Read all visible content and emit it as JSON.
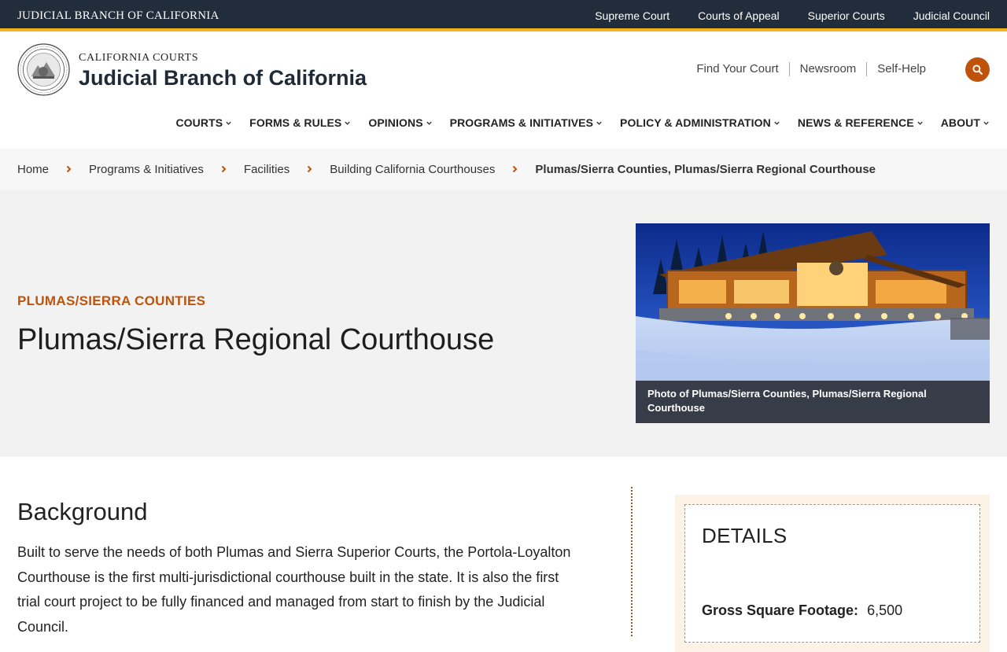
{
  "topbar": {
    "brand": "JUDICIAL BRANCH OF CALIFORNIA",
    "links": [
      "Supreme Court",
      "Courts of Appeal",
      "Superior Courts",
      "Judicial Council"
    ]
  },
  "header": {
    "small_title": "CALIFORNIA COURTS",
    "big_title": "Judicial Branch of California",
    "utility_links": [
      "Find Your Court",
      "Newsroom",
      "Self-Help"
    ],
    "search_icon": "search-icon",
    "accent_color": "#c0530b",
    "dark_color": "#212d3a",
    "gold_color": "#f2b31b"
  },
  "nav": {
    "items": [
      "COURTS",
      "FORMS & RULES",
      "OPINIONS",
      "PROGRAMS & INITIATIVES",
      "POLICY & ADMINISTRATION",
      "NEWS & REFERENCE",
      "ABOUT"
    ]
  },
  "breadcrumb": {
    "items": [
      "Home",
      "Programs & Initiatives",
      "Facilities",
      "Building California Courthouses"
    ],
    "current": "Plumas/Sierra Counties, Plumas/Sierra Regional Courthouse"
  },
  "hero": {
    "eyebrow": "PLUMAS/SIERRA COUNTIES",
    "title": "Plumas/Sierra Regional Courthouse",
    "caption": "Photo of Plumas/Sierra Counties, Plumas/Sierra Regional Courthouse"
  },
  "content": {
    "heading": "Background",
    "body": "Built to serve the needs of both Plumas and Sierra Superior Courts, the Portola-Loyalton Courthouse is the first multi-jurisdictional courthouse built in the state. It is also the first trial court project to be fully financed and managed from start to finish by the Judicial Council."
  },
  "details": {
    "title": "DETAILS",
    "rows": [
      {
        "label": "Gross Square Footage:",
        "value": "6,500"
      }
    ]
  }
}
